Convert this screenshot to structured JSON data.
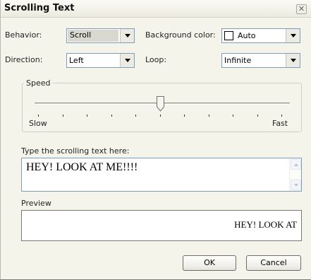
{
  "window": {
    "title": "Scrolling Text",
    "close_glyph": "✕"
  },
  "behavior": {
    "label": "Behavior:",
    "value": "Scroll"
  },
  "background_color": {
    "label": "Background color:",
    "value": "Auto"
  },
  "direction": {
    "label": "Direction:",
    "value": "Left"
  },
  "loop": {
    "label": "Loop:",
    "value": "Infinite"
  },
  "speed": {
    "legend": "Speed",
    "min_label": "Slow",
    "max_label": "Fast",
    "tick_count": 11,
    "value_fraction": 0.5
  },
  "scrolling_text": {
    "label": "Type the scrolling text here:",
    "value": "HEY! LOOK AT ME!!!!"
  },
  "preview": {
    "label": "Preview",
    "text": "HEY! LOOK AT"
  },
  "buttons": {
    "ok": "OK",
    "cancel": "Cancel"
  }
}
